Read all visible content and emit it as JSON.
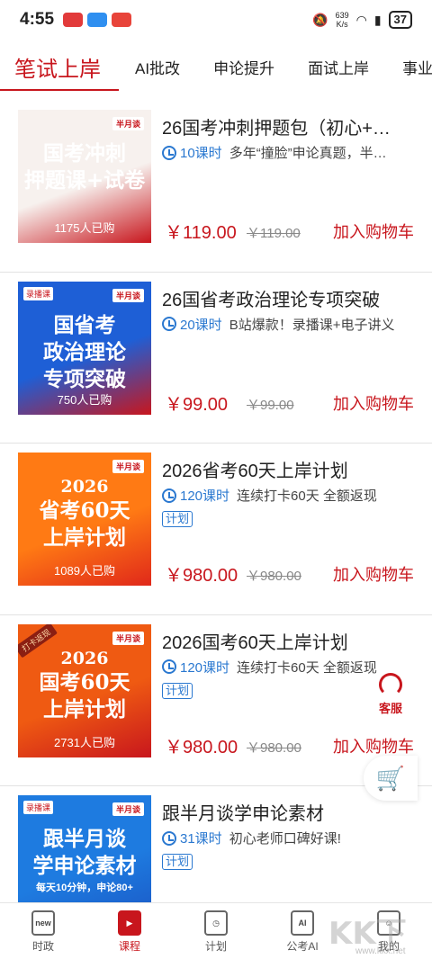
{
  "status_bar": {
    "time": "4:55",
    "net_speed": "639",
    "net_unit": "K/s",
    "battery": "37"
  },
  "tabs": [
    {
      "label": "笔试上岸",
      "active": true
    },
    {
      "label": "AI批改"
    },
    {
      "label": "申论提升"
    },
    {
      "label": "面试上岸"
    },
    {
      "label": "事业"
    }
  ],
  "courses": [
    {
      "cover": {
        "brand": "半月谈",
        "tag": "",
        "year": "",
        "title_lines": [
          "国考冲刺",
          "押题课+试卷"
        ],
        "sub": "",
        "sold": "1175人已购",
        "colors": [
          "#f7f1ee",
          "#c8161d"
        ]
      },
      "title": "26国考冲刺押题包（初心+…",
      "lessons": "10课时",
      "desc": "多年“撞脸”申论真题，半…",
      "badge": "",
      "price": "￥119.00",
      "old_price": "￥119.00",
      "cart_label": "加入购物车"
    },
    {
      "cover": {
        "brand": "半月谈",
        "tag": "录播课",
        "year": "",
        "title_lines": [
          "国省考",
          "政治理论",
          "专项突破"
        ],
        "sub": "",
        "sold": "750人已购",
        "colors": [
          "#1e5fd6",
          "#c8161d"
        ]
      },
      "title": "26国省考政治理论专项突破",
      "lessons": "20课时",
      "desc": "B站爆款！录播课+电子讲义",
      "badge": "",
      "price": "￥99.00",
      "old_price": "￥99.00",
      "cart_label": "加入购物车"
    },
    {
      "cover": {
        "brand": "半月谈",
        "tag": "",
        "year": "2026",
        "title_lines": [
          "省考60天",
          "上岸计划"
        ],
        "sub": "",
        "sold": "1089人已购",
        "colors": [
          "#ff7a14",
          "#e0281a"
        ]
      },
      "title": "2026省考60天上岸计划",
      "lessons": "120课时",
      "desc": "连续打卡60天 全额返现",
      "badge": "计划",
      "price": "￥980.00",
      "old_price": "￥980.00",
      "cart_label": "加入购物车"
    },
    {
      "cover": {
        "brand": "半月谈",
        "tag": "打卡返现",
        "year": "2026",
        "title_lines": [
          "国考60天",
          "上岸计划"
        ],
        "sub": "",
        "sold": "2731人已购",
        "colors": [
          "#ef5a12",
          "#c8161d"
        ]
      },
      "title": "2026国考60天上岸计划",
      "lessons": "120课时",
      "desc": "连续打卡60天 全额返现",
      "badge": "计划",
      "price": "￥980.00",
      "old_price": "￥980.00",
      "cart_label": "加入购物车"
    },
    {
      "cover": {
        "brand": "半月谈",
        "tag": "录播课",
        "year": "",
        "title_lines": [
          "跟半月谈",
          "学申论素材"
        ],
        "sub": "每天10分钟，申论80+",
        "sold": "",
        "colors": [
          "#1e7be0",
          "#1a56c4"
        ]
      },
      "title": "跟半月谈学申论素材",
      "lessons": "31课时",
      "desc": "初心老师口碑好课!",
      "badge": "计划",
      "price": "",
      "old_price": "",
      "cart_label": ""
    }
  ],
  "float": {
    "service_label": "客服"
  },
  "bottom_nav": [
    {
      "label": "时政",
      "icon_text": "new"
    },
    {
      "label": "课程",
      "icon_text": "▶",
      "active": true
    },
    {
      "label": "计划",
      "icon_text": "◷"
    },
    {
      "label": "公考AI",
      "icon_text": "AI"
    },
    {
      "label": "我的",
      "icon_text": "☺"
    }
  ],
  "colors": {
    "accent": "#c8161d",
    "link": "#2a78d0"
  }
}
